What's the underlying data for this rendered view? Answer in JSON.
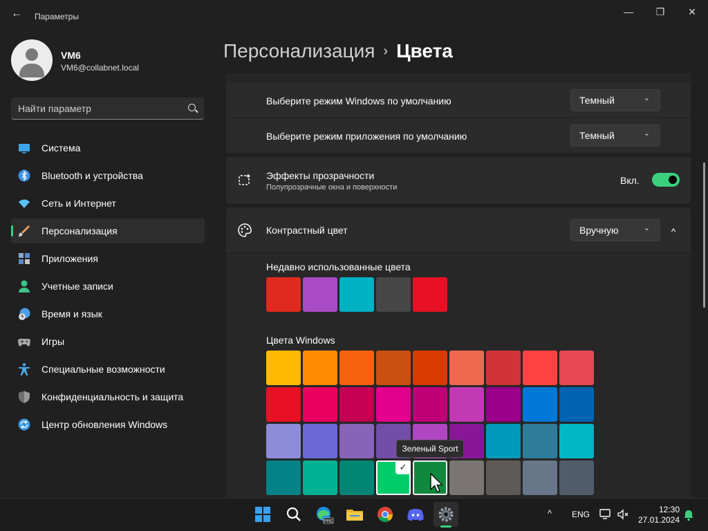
{
  "window": {
    "title": "Параметры",
    "back_icon": "←",
    "minimize_icon": "—",
    "maximize_icon": "❐",
    "close_icon": "✕"
  },
  "user": {
    "name": "VM6",
    "email": "VM6@collabnet.local"
  },
  "search": {
    "placeholder": "Найти параметр"
  },
  "nav_items": [
    {
      "label": "Система",
      "icon": "system-icon",
      "color": "#3ea6e8"
    },
    {
      "label": "Bluetooth и устройства",
      "icon": "bluetooth-icon",
      "color": "#3a8ee6"
    },
    {
      "label": "Сеть и Интернет",
      "icon": "wifi-icon",
      "color": "#5bc0f5"
    },
    {
      "label": "Персонализация",
      "icon": "brush-icon",
      "color": "#e8a060",
      "active": true
    },
    {
      "label": "Приложения",
      "icon": "apps-icon",
      "color": "#8aa8c8"
    },
    {
      "label": "Учетные записи",
      "icon": "account-icon",
      "color": "#3bc48b"
    },
    {
      "label": "Время и язык",
      "icon": "clock-globe-icon",
      "color": "#4a9ee6"
    },
    {
      "label": "Игры",
      "icon": "gamepad-icon",
      "color": "#a8a8a8"
    },
    {
      "label": "Специальные возможности",
      "icon": "accessibility-icon",
      "color": "#4aa8e8"
    },
    {
      "label": "Конфиденциальность и защита",
      "icon": "shield-icon",
      "color": "#9a9a9a"
    },
    {
      "label": "Центр обновления Windows",
      "icon": "update-icon",
      "color": "#3a96e6"
    }
  ],
  "breadcrumb": {
    "parent": "Персонализация",
    "separator": "›",
    "current": "Цвета"
  },
  "settings": {
    "windows_mode_label": "Выберите режим Windows по умолчанию",
    "windows_mode_value": "Темный",
    "app_mode_label": "Выберите режим приложения по умолчанию",
    "app_mode_value": "Темный",
    "transparency_label": "Эффекты прозрачности",
    "transparency_desc": "Полупрозрачные окна и поверхности",
    "transparency_state": "Вкл.",
    "accent_label": "Контрастный цвет",
    "accent_value": "Вручную",
    "chevron_down": "⌄",
    "chevron_up": "^"
  },
  "recent_colors": {
    "title": "Недавно использованные цвета",
    "colors": [
      "#e0291f",
      "#a94bc4",
      "#00b1c4",
      "#474747",
      "#e81123"
    ]
  },
  "windows_colors": {
    "title": "Цвета Windows",
    "rows": [
      [
        "#ffb900",
        "#ff8c00",
        "#f7630c",
        "#ca5010",
        "#da3b01",
        "#ef6950",
        "#d13438",
        "#ff4343",
        "#e74856"
      ],
      [
        "#e81123",
        "#ea005e",
        "#c30052",
        "#e3008c",
        "#bf0077",
        "#c239b3",
        "#9a0089",
        "#0078d7",
        "#0063b1"
      ],
      [
        "#8e8cd8",
        "#6b69d6",
        "#8764b8",
        "#744da9",
        "#b146c2",
        "#881798",
        "#0099bc",
        "#2d7d9a",
        "#00b7c3"
      ],
      [
        "#038387",
        "#00b294",
        "#018574",
        "#00cc6a",
        "#10893e",
        "#7a7574",
        "#5d5a58",
        "#68768a",
        "#515c6b"
      ]
    ],
    "selected_index": [
      3,
      3
    ],
    "check_icon": "✓"
  },
  "tooltip": "Зеленый Sport",
  "taskbar": {
    "apps": [
      "windows-start-icon",
      "search-icon",
      "edge-beta-icon",
      "file-explorer-icon",
      "chrome-icon",
      "discord-icon",
      "settings-gear-icon"
    ],
    "chevron": "^",
    "language": "ENG",
    "time": "12:30",
    "date": "27.01.2024"
  }
}
